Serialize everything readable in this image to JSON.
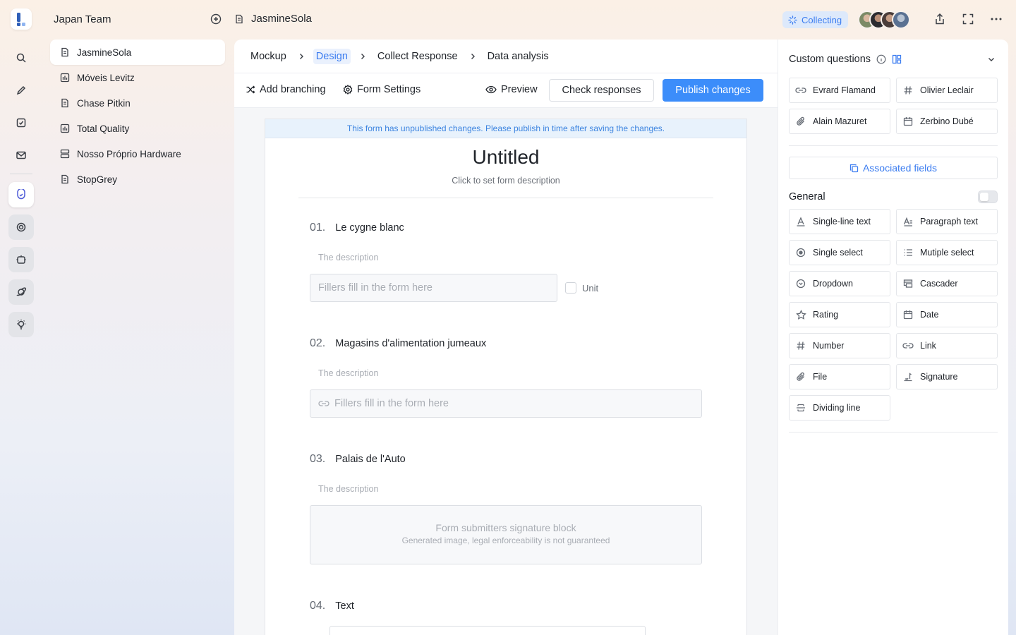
{
  "team": "Japan Team",
  "tree_items": [
    {
      "label": "JasmineSola",
      "icon": "document-icon"
    },
    {
      "label": "Móveis Levitz",
      "icon": "chart-table-icon"
    },
    {
      "label": "Chase Pitkin",
      "icon": "document-icon"
    },
    {
      "label": "Total Quality",
      "icon": "chart-table-icon"
    },
    {
      "label": "Nosso Próprio Hardware",
      "icon": "database-icon"
    },
    {
      "label": "StopGrey",
      "icon": "document-icon"
    }
  ],
  "topbar": {
    "doc_title": "JasmineSola",
    "status": "Collecting"
  },
  "breadcrumbs": [
    "Mockup",
    "Design",
    "Collect Response",
    "Data analysis"
  ],
  "toolbar": {
    "add_branching": "Add branching",
    "form_settings": "Form Settings",
    "preview": "Preview",
    "check_responses": "Check responses",
    "publish": "Publish changes"
  },
  "form": {
    "notice": "This form has unpublished changes. Please publish in time after saving the changes.",
    "title": "Untitled",
    "description": "Click to set form description",
    "questions": [
      {
        "num": "01.",
        "title": "Le cygne blanc",
        "description": "The description",
        "placeholder": "Fillers fill in the form here",
        "unit_label": "Unit"
      },
      {
        "num": "02.",
        "title": "Magasins d'alimentation jumeaux",
        "description": "The description",
        "placeholder": "Fillers fill in the form here"
      },
      {
        "num": "03.",
        "title": "Palais de l'Auto",
        "description": "The description",
        "signature_title": "Form submitters signature block",
        "signature_note": "Generated image, legal enforceability is not guaranteed"
      },
      {
        "num": "04.",
        "title": "Text"
      }
    ]
  },
  "panel": {
    "custom_title": "Custom questions",
    "custom_questions": [
      {
        "label": "Evrard Flamand",
        "icon": "link-icon"
      },
      {
        "label": "Olivier Leclair",
        "icon": "hash-icon"
      },
      {
        "label": "Alain Mazuret",
        "icon": "paperclip-icon"
      },
      {
        "label": "Zerbino Dubé",
        "icon": "calendar-icon"
      }
    ],
    "associated_fields": "Associated fields",
    "general_title": "General",
    "field_types": [
      {
        "label": "Single-line text",
        "icon": "text-a-icon"
      },
      {
        "label": "Paragraph text",
        "icon": "paragraph-icon"
      },
      {
        "label": "Single select",
        "icon": "radio-icon"
      },
      {
        "label": "Mutiple select",
        "icon": "list-icon"
      },
      {
        "label": "Dropdown",
        "icon": "dropdown-icon"
      },
      {
        "label": "Cascader",
        "icon": "cascader-icon"
      },
      {
        "label": "Rating",
        "icon": "star-icon"
      },
      {
        "label": "Date",
        "icon": "calendar-icon"
      },
      {
        "label": "Number",
        "icon": "hash-icon"
      },
      {
        "label": "Link",
        "icon": "link-icon"
      },
      {
        "label": "File",
        "icon": "paperclip-icon"
      },
      {
        "label": "Signature",
        "icon": "signature-icon"
      },
      {
        "label": "Dividing line",
        "icon": "divider-icon"
      }
    ]
  },
  "colors": {
    "accent": "#3c8dfa",
    "status_bg": "#dde9fb",
    "notice_bg": "#e8f2fc"
  }
}
